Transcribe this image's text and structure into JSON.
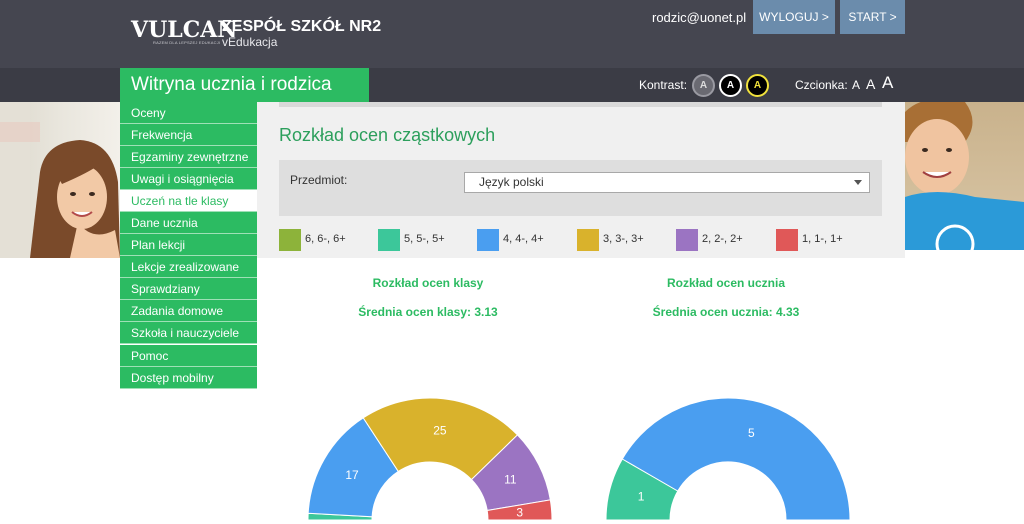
{
  "header": {
    "logo": "VULCAN",
    "logo_tagline": "RAZEM DLA LEPSZEJ EDUKACJI",
    "school_name": "ZESPÓŁ SZKÓŁ NR2",
    "school_sub": "vEdukacja",
    "user_email": "rodzic@uonet.pl",
    "logout_label": "WYLOGUJ >",
    "start_label": "START >"
  },
  "subbar": {
    "portal_title": "Witryna ucznia i rodzica",
    "contrast_label": "Kontrast:",
    "contrast_options": [
      "A",
      "A",
      "A"
    ],
    "font_label": "Czcionka:",
    "font_sizes": [
      "A",
      "A",
      "A"
    ]
  },
  "sidebar": {
    "items": [
      {
        "label": "Oceny",
        "active": false
      },
      {
        "label": "Frekwencja",
        "active": false
      },
      {
        "label": "Egzaminy zewnętrzne",
        "active": false
      },
      {
        "label": "Uwagi i osiągnięcia",
        "active": false
      },
      {
        "label": "Uczeń na tle klasy",
        "active": true
      },
      {
        "label": "Dane ucznia",
        "active": false
      },
      {
        "label": "Plan lekcji",
        "active": false
      },
      {
        "label": "Lekcje zrealizowane",
        "active": false
      },
      {
        "label": "Sprawdziany",
        "active": false
      },
      {
        "label": "Zadania domowe",
        "active": false
      },
      {
        "label": "Szkoła i nauczyciele",
        "active": false
      },
      {
        "label": "Pomoc",
        "active": false
      },
      {
        "label": "Dostęp mobilny",
        "active": false
      }
    ]
  },
  "main": {
    "title": "Rozkład ocen cząstkowych",
    "filter_label": "Przedmiot:",
    "subject_value": "Język polski"
  },
  "legend": [
    {
      "label": "6, 6-, 6+",
      "color": "#8db33a"
    },
    {
      "label": "5, 5-, 5+",
      "color": "#3cc79a"
    },
    {
      "label": "4, 4-, 4+",
      "color": "#4a9ef0"
    },
    {
      "label": "3, 3-, 3+",
      "color": "#d9b22c"
    },
    {
      "label": "2, 2-, 2+",
      "color": "#9b74c2"
    },
    {
      "label": "1, 1-, 1+",
      "color": "#e05858"
    }
  ],
  "charts": {
    "class_title": "Rozkład ocen klasy",
    "class_avg": "Średnia ocen klasy: 3.13",
    "student_title": "Rozkład ocen ucznia",
    "student_avg": "Średnia ocen ucznia: 4.33"
  },
  "chart_data": [
    {
      "type": "pie",
      "title": "Rozkład ocen klasy",
      "categories": [
        "6, 6-, 6+",
        "5, 5-, 5+",
        "4, 4-, 4+",
        "3, 3-, 3+",
        "2, 2-, 2+",
        "1, 1-, 1+"
      ],
      "values": [
        0,
        1,
        17,
        25,
        11,
        3
      ],
      "value_labels": [
        "",
        "",
        "17",
        "25",
        "11",
        "3"
      ]
    },
    {
      "type": "pie",
      "title": "Rozkład ocen ucznia",
      "categories": [
        "6, 6-, 6+",
        "5, 5-, 5+",
        "4, 4-, 4+",
        "3, 3-, 3+",
        "2, 2-, 2+",
        "1, 1-, 1+"
      ],
      "values": [
        0,
        1,
        5,
        0,
        0,
        0
      ],
      "value_labels": [
        "",
        "1",
        "5",
        "",
        "",
        ""
      ]
    }
  ]
}
